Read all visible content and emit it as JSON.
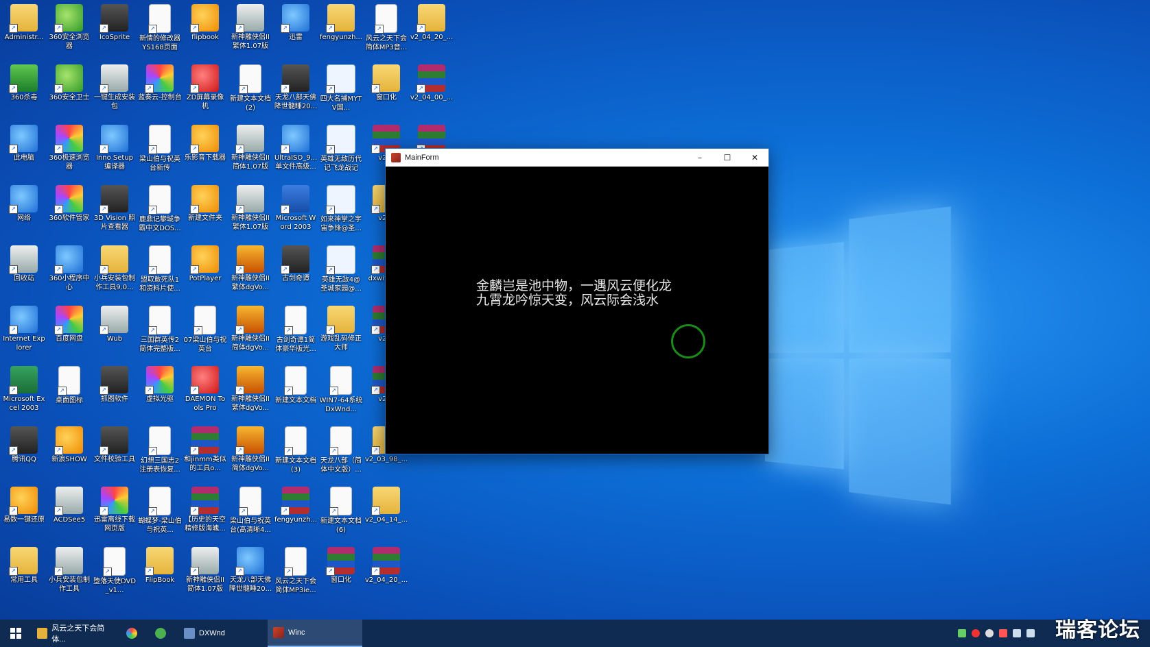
{
  "window": {
    "title": "MainForm",
    "minimize": "–",
    "maximize": "☐",
    "close": "✕",
    "poem_line1": "金麟岂是池中物，一遇风云便化龙",
    "poem_line2": "九霄龙吟惊天变，风云际会浅水"
  },
  "taskbar": {
    "items": [
      {
        "label": "风云之天下会简体..."
      },
      {
        "label": ""
      },
      {
        "label": ""
      },
      {
        "label": "DXWnd"
      },
      {
        "label": "Winc"
      }
    ]
  },
  "watermark": "瑞客论坛",
  "desktop_icons": [
    {
      "label": "Administr...",
      "kind": "p-folder"
    },
    {
      "label": "360安全浏览器",
      "kind": "p-green"
    },
    {
      "label": "IcoSprite",
      "kind": "p-dark"
    },
    {
      "label": "新情的修改器YS168页面",
      "kind": "p-doc"
    },
    {
      "label": "flipbook",
      "kind": "p-orange"
    },
    {
      "label": "新神雕侠侣II繁体1.07版",
      "kind": "p-gray"
    },
    {
      "label": "迅雷",
      "kind": "p-blue"
    },
    {
      "label": "fengyunzh...",
      "kind": "p-folder"
    },
    {
      "label": "风云之天下会简体MP3音...",
      "kind": "p-doc"
    },
    {
      "label": "v2_04_20_...",
      "kind": "p-folder"
    },
    {
      "label": "360杀毒",
      "kind": "p-shield"
    },
    {
      "label": "360安全卫士",
      "kind": "p-green"
    },
    {
      "label": "一键生成安装包",
      "kind": "p-gray"
    },
    {
      "label": "蓝奏云-控制台",
      "kind": "p-color"
    },
    {
      "label": "ZD屏幕录像机",
      "kind": "p-red"
    },
    {
      "label": "新建文本文档(2)",
      "kind": "p-doc"
    },
    {
      "label": "天龙八部天佛降世髓睡20...",
      "kind": "p-dark"
    },
    {
      "label": "四大名捕MYTV国...",
      "kind": "p-bt"
    },
    {
      "label": "窗口化",
      "kind": "p-folder"
    },
    {
      "label": "v2_04_00_...",
      "kind": "p-winrar"
    },
    {
      "label": "此电脑",
      "kind": "p-blue"
    },
    {
      "label": "360极速浏览器",
      "kind": "p-color"
    },
    {
      "label": "Inno Setup编译器",
      "kind": "p-blue"
    },
    {
      "label": "梁山伯与祝英台新传",
      "kind": "p-doc"
    },
    {
      "label": "乐影音下载器",
      "kind": "p-orange"
    },
    {
      "label": "新神雕侠侣II简体1.07版",
      "kind": "p-gray"
    },
    {
      "label": "UltraISO_9...单文件高级...",
      "kind": "p-blue"
    },
    {
      "label": "英雄无敌历代记飞龙战记",
      "kind": "p-bt"
    },
    {
      "label": "v2_0",
      "kind": "p-winrar"
    },
    {
      "label": "",
      "kind": "p-winrar"
    },
    {
      "label": "网络",
      "kind": "p-blue"
    },
    {
      "label": "360软件管家",
      "kind": "p-color"
    },
    {
      "label": "3D Vision 照片查看器",
      "kind": "p-dark"
    },
    {
      "label": "鹿鼎记攀城争霸中文DOS...",
      "kind": "p-doc"
    },
    {
      "label": "新建文件夹",
      "kind": "p-orange"
    },
    {
      "label": "新神雕侠侣II繁体1.07版",
      "kind": "p-gray"
    },
    {
      "label": "Microsoft Word 2003",
      "kind": "p-word"
    },
    {
      "label": "如来神掌之宇宙争锋@圣...",
      "kind": "p-bt"
    },
    {
      "label": "v2_0",
      "kind": "p-folder"
    },
    {
      "label": "",
      "kind": ""
    },
    {
      "label": "回收站",
      "kind": "p-gray"
    },
    {
      "label": "360小程序中心",
      "kind": "p-blue"
    },
    {
      "label": "小兵安装包制作工具9.0...",
      "kind": "p-folder"
    },
    {
      "label": "盟取敢死队1和资料片使...",
      "kind": "p-doc"
    },
    {
      "label": "PotPlayer",
      "kind": "p-orange"
    },
    {
      "label": "新神雕侠侣II繁体dgVo...",
      "kind": "p-ctrl"
    },
    {
      "label": "古剑奇谭",
      "kind": "p-dark"
    },
    {
      "label": "英雄无敌4@圣城家园@...",
      "kind": "p-bt"
    },
    {
      "label": "dxwi汉化...",
      "kind": "p-winrar"
    },
    {
      "label": "",
      "kind": ""
    },
    {
      "label": "Internet Explorer",
      "kind": "p-blue"
    },
    {
      "label": "百度网盘",
      "kind": "p-color"
    },
    {
      "label": "Wub",
      "kind": "p-gray"
    },
    {
      "label": "三国群英传2简体完整版...",
      "kind": "p-doc"
    },
    {
      "label": "07梁山伯与祝英台",
      "kind": "p-doc"
    },
    {
      "label": "新神雕侠侣II简体dgVo...",
      "kind": "p-ctrl"
    },
    {
      "label": "古剑奇谭1简体豪华版光...",
      "kind": "p-doc"
    },
    {
      "label": "游戏乱码修正大师",
      "kind": "p-folder"
    },
    {
      "label": "v2_0",
      "kind": "p-winrar"
    },
    {
      "label": "",
      "kind": ""
    },
    {
      "label": "Microsoft Excel 2003",
      "kind": "p-excel"
    },
    {
      "label": "桌面图标",
      "kind": "p-doc"
    },
    {
      "label": "抓图软件",
      "kind": "p-dark"
    },
    {
      "label": "虚拟光驱",
      "kind": "p-color"
    },
    {
      "label": "DAEMON Tools Pro",
      "kind": "p-red"
    },
    {
      "label": "新神雕侠侣II繁体dgVo...",
      "kind": "p-ctrl"
    },
    {
      "label": "新建文本文档",
      "kind": "p-doc"
    },
    {
      "label": "WIN7-64系统DxWnd...",
      "kind": "p-doc"
    },
    {
      "label": "v2_0",
      "kind": "p-winrar"
    },
    {
      "label": "",
      "kind": ""
    },
    {
      "label": "腾讯QQ",
      "kind": "p-dark"
    },
    {
      "label": "新浪SHOW",
      "kind": "p-orange"
    },
    {
      "label": "文件校验工具",
      "kind": "p-dark"
    },
    {
      "label": "幻想三国志2注册表恢复...",
      "kind": "p-doc"
    },
    {
      "label": "和jinmm类似的工具o...",
      "kind": "p-winrar"
    },
    {
      "label": "新神雕侠侣II简体dgVo...",
      "kind": "p-ctrl"
    },
    {
      "label": "新建文本文档(3)",
      "kind": "p-doc"
    },
    {
      "label": "天龙八部（简体中文版）...",
      "kind": "p-doc"
    },
    {
      "label": "v2_03_98_...",
      "kind": "p-folder"
    },
    {
      "label": "",
      "kind": ""
    },
    {
      "label": "易数一键还原",
      "kind": "p-orange"
    },
    {
      "label": "ACDSee5",
      "kind": "p-gray"
    },
    {
      "label": "迅雷离线下载网页版",
      "kind": "p-color"
    },
    {
      "label": "蝴蝶梦-梁山伯与祝英...",
      "kind": "p-doc"
    },
    {
      "label": "【历史的天空精修版海魄...",
      "kind": "p-winrar"
    },
    {
      "label": "梁山伯与祝英台(高清晰4...",
      "kind": "p-doc"
    },
    {
      "label": "fengyunzh...",
      "kind": "p-winrar"
    },
    {
      "label": "新建文本文档(6)",
      "kind": "p-doc"
    },
    {
      "label": "v2_04_14_...",
      "kind": "p-folder"
    },
    {
      "label": "",
      "kind": ""
    },
    {
      "label": "常用工具",
      "kind": "p-folder"
    },
    {
      "label": "小兵安装包制作工具",
      "kind": "p-gray"
    },
    {
      "label": "堕落天使DVD_v1...",
      "kind": "p-doc"
    },
    {
      "label": "FlipBook",
      "kind": "p-folder"
    },
    {
      "label": "新神雕侠侣II简体1.07版",
      "kind": "p-gray"
    },
    {
      "label": "天龙八部天佛降世髓睡20...",
      "kind": "p-blue"
    },
    {
      "label": "风云之天下会简体MP3ie...",
      "kind": "p-doc"
    },
    {
      "label": "窗口化",
      "kind": "p-winrar"
    },
    {
      "label": "v2_04_20_...",
      "kind": "p-winrar"
    },
    {
      "label": "",
      "kind": ""
    }
  ]
}
